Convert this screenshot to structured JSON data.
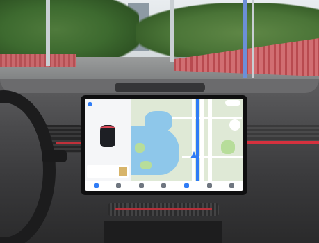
{
  "scene": {
    "description_tokens": [],
    "colors": {
      "screen_bezel": "#0f0f10",
      "map_water": "#8ec7ea",
      "route_line": "#2f7cf6",
      "accent_red": "#d6313e"
    }
  },
  "screen": {
    "left_panel": {
      "pin_icon": "location-pin-icon",
      "vehicle_icon": "car-top-view-icon"
    },
    "map": {
      "nav_icon": "navigation-arrow-icon"
    },
    "taskbar": {
      "icons": [
        "home-icon",
        "apps-icon",
        "media-icon",
        "phone-icon",
        "map-icon",
        "settings-icon",
        "volume-icon"
      ]
    }
  }
}
